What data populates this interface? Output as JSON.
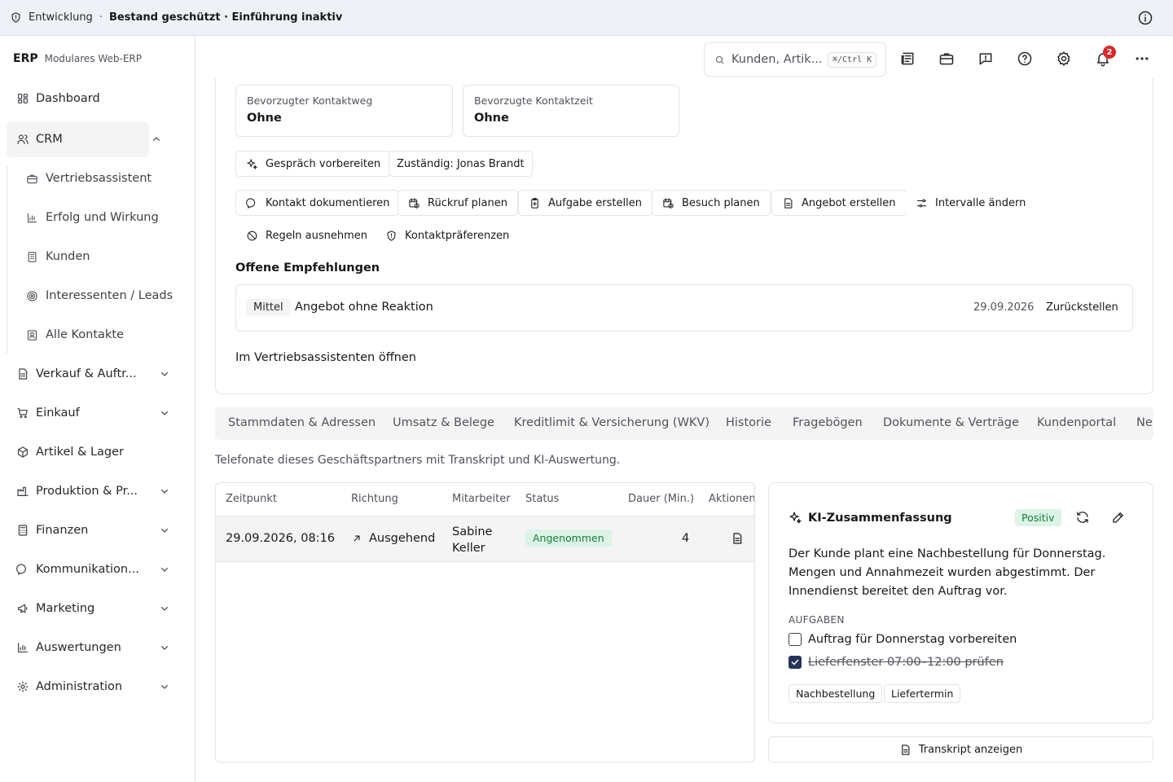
{
  "banner": {
    "environment": "Entwicklung",
    "separator": "·",
    "status": "Bestand geschützt · Einführung inaktiv"
  },
  "brand": {
    "name": "ERP",
    "subtitle": "Modulares Web-ERP"
  },
  "sidebar": {
    "items": [
      {
        "label": "Dashboard",
        "icon": "dashboard-icon"
      },
      {
        "label": "CRM",
        "icon": "users-icon",
        "expanded": true
      },
      {
        "label": "Verkauf & Auftr...",
        "icon": "document-icon"
      },
      {
        "label": "Einkauf",
        "icon": "cart-icon"
      },
      {
        "label": "Artikel & Lager",
        "icon": "package-icon"
      },
      {
        "label": "Produktion & Pr...",
        "icon": "factory-icon"
      },
      {
        "label": "Finanzen",
        "icon": "calculator-icon"
      },
      {
        "label": "Kommunikation...",
        "icon": "chat-icon"
      },
      {
        "label": "Marketing",
        "icon": "megaphone-icon"
      },
      {
        "label": "Auswertungen",
        "icon": "chart-icon"
      },
      {
        "label": "Administration",
        "icon": "gear-icon"
      }
    ],
    "crm_sub": [
      {
        "label": "Vertriebsassistent",
        "icon": "briefcase-icon"
      },
      {
        "label": "Erfolg und Wirkung",
        "icon": "chart-icon"
      },
      {
        "label": "Kunden",
        "icon": "building-icon"
      },
      {
        "label": "Interessenten / Leads",
        "icon": "target-icon"
      },
      {
        "label": "Alle Kontakte",
        "icon": "contact-icon"
      }
    ]
  },
  "header": {
    "search_placeholder": "Kunden, Artik...",
    "shortcut": "⌘/Ctrl K",
    "notification_count": "2"
  },
  "contact": {
    "channel_label": "Bevorzugter Kontaktweg",
    "channel_value": "Ohne",
    "time_label": "Bevorzugte Kontaktzeit",
    "time_value": "Ohne"
  },
  "actions": {
    "prepare_call": "Gespräch vorbereiten",
    "owner": "Zuständig: Jonas Brandt",
    "document_contact": "Kontakt dokumentieren",
    "plan_callback": "Rückruf planen",
    "create_task": "Aufgabe erstellen",
    "plan_visit": "Besuch planen",
    "create_offer": "Angebot erstellen",
    "change_intervals": "Intervalle ändern",
    "exclude_rules": "Regeln ausnehmen",
    "contact_prefs": "Kontaktpräferenzen"
  },
  "recommendations": {
    "title": "Offene Empfehlungen",
    "items": [
      {
        "priority": "Mittel",
        "title": "Angebot ohne Reaktion",
        "date": "29.09.2026",
        "action": "Zurückstellen"
      }
    ],
    "open_link": "Im Vertriebsassistenten öffnen"
  },
  "tabs": [
    "Stammdaten & Adressen",
    "Umsatz & Belege",
    "Kreditlimit & Versicherung (WKV)",
    "Historie",
    "Fragebögen",
    "Dokumente & Verträge",
    "Kundenportal",
    "Ne"
  ],
  "calls": {
    "description": "Telefonate dieses Geschäftspartners mit Transkript und KI-Auswertung.",
    "columns": [
      "Zeitpunkt",
      "Richtung",
      "Mitarbeiter",
      "Status",
      "Dauer (Min.)",
      "Aktionen"
    ],
    "rows": [
      {
        "time": "29.09.2026, 08:16",
        "direction": "Ausgehend",
        "employee_first": "Sabine",
        "employee_last": "Keller",
        "status": "Angenommen",
        "duration": "4"
      }
    ]
  },
  "ai_summary": {
    "title": "KI-Zusammenfassung",
    "sentiment": "Positiv",
    "text": "Der Kunde plant eine Nachbestellung für Donnerstag. Mengen und Annahmezeit wurden abgestimmt. Der Innendienst bereitet den Auftrag vor.",
    "tasks_label": "AUFGABEN",
    "tasks": [
      {
        "label": "Auftrag für Donnerstag vorbereiten",
        "done": false
      },
      {
        "label": "Lieferfenster 07:00–12:00 prüfen",
        "done": true
      }
    ],
    "tags": [
      "Nachbestellung",
      "Liefertermin"
    ],
    "transcript_button": "Transkript anzeigen"
  }
}
